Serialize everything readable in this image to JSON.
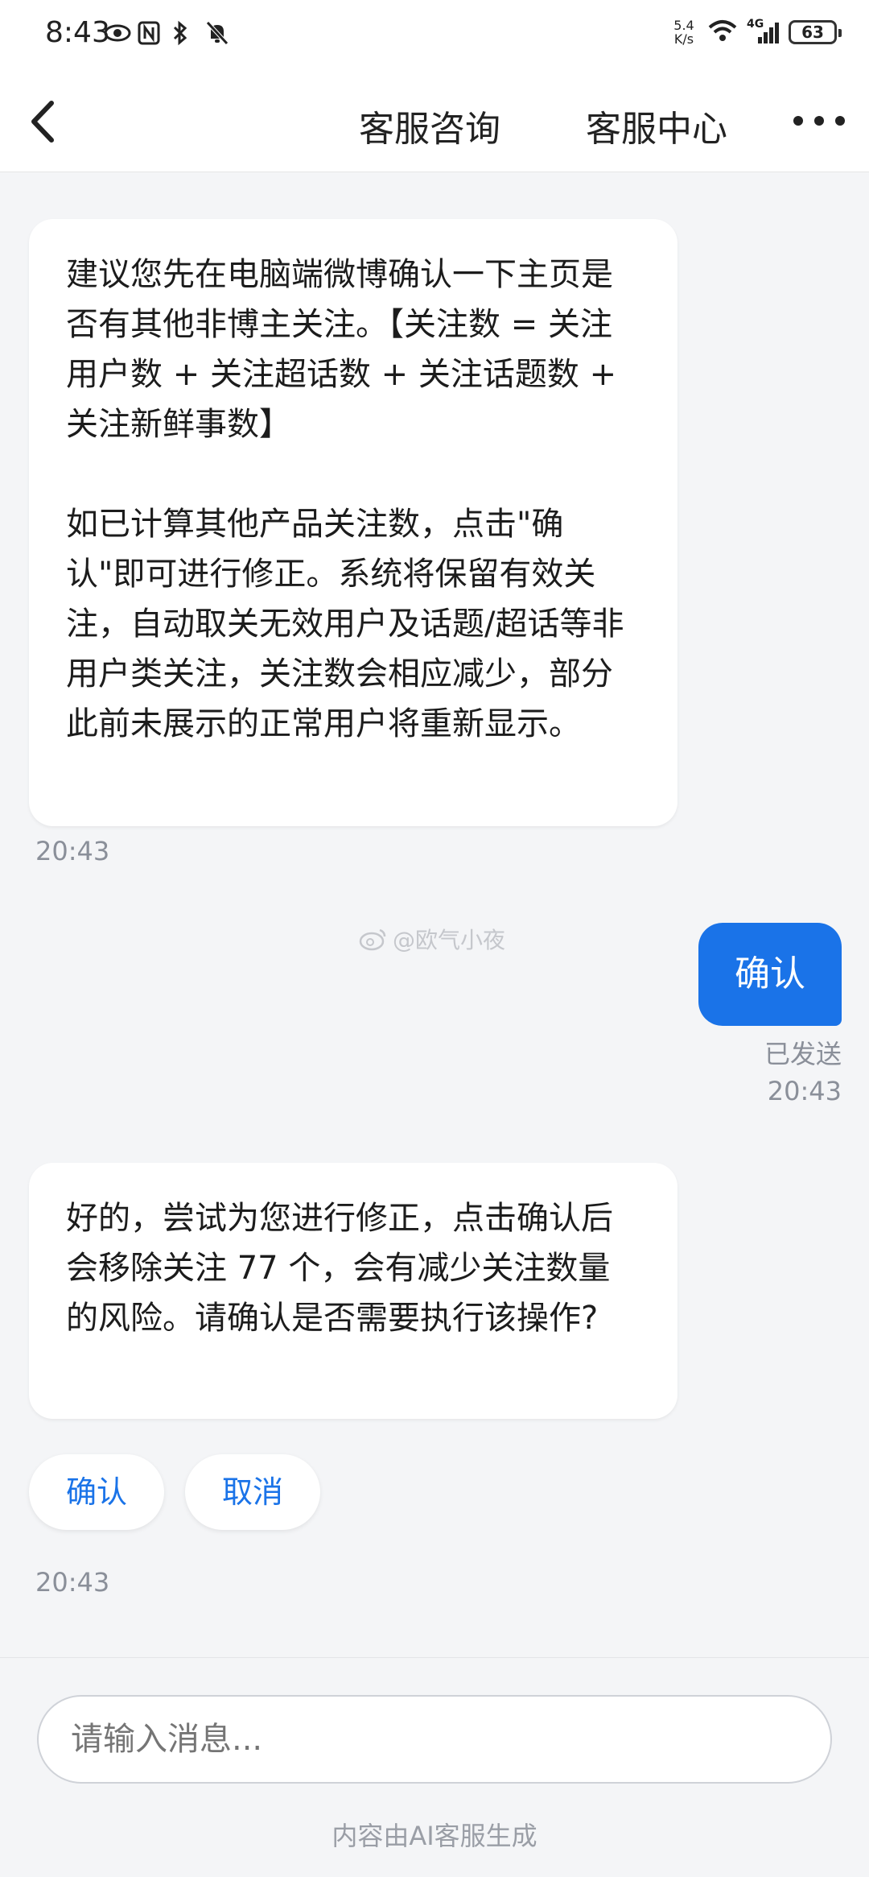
{
  "status_bar": {
    "time": "8:43",
    "net_speed_value": "5.4",
    "net_speed_unit": "K/s",
    "network_type": "4G",
    "battery": "63",
    "icons": [
      "eye-icon",
      "nfc-icon",
      "bluetooth-icon",
      "mute-icon",
      "wifi-icon",
      "signal-icon",
      "battery-icon"
    ]
  },
  "nav": {
    "tab_consult": "客服咨询",
    "tab_center": "客服中心"
  },
  "messages": {
    "bot1": {
      "text": "建议您先在电脑端微博确认一下主页是否有其他非博主关注。【关注数 = 关注用户数 + 关注超话数 + 关注话题数 + 关注新鲜事数】\n\n如已计算其他产品关注数，点击\"确认\"即可进行修正。系统将保留有效关注，自动取关无效用户及话题/超话等非用户类关注，关注数会相应减少，部分此前未展示的正常用户将重新显示。",
      "time": "20:43"
    },
    "user1": {
      "text": "确认",
      "status": "已发送",
      "time": "20:43"
    },
    "bot2": {
      "text": "好的，尝试为您进行修正，点击确认后会移除关注 77 个，会有减少关注数量的风险。请确认是否需要执行该操作?",
      "time": "20:43"
    },
    "actions": {
      "confirm": "确认",
      "cancel": "取消"
    }
  },
  "watermark": "@欧气小夜",
  "input": {
    "placeholder": "请输入消息..."
  },
  "footer_note": "内容由AI客服生成",
  "colors": {
    "accent": "#1a73e8",
    "background": "#f4f5f7"
  }
}
